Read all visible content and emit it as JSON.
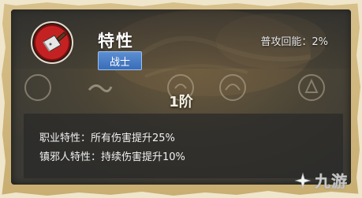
{
  "trait": {
    "title": "特性",
    "class_badge": "战士",
    "stat_label": "普攻回能：",
    "stat_value": "2%",
    "level": "1阶",
    "tier_labels": [
      "1阶",
      "",
      "",
      "",
      "",
      ""
    ]
  },
  "description": {
    "line1_label": "职业特性：",
    "line1_text": "所有伤害提升25%",
    "line2_label": "镇邪人特性：",
    "line2_text": "持续伤害提升10%"
  },
  "watermark": {
    "text": "九游"
  },
  "colors": {
    "frame": "#d7c08a",
    "badge": "#3a6db8",
    "emblem_red": "#c42222"
  }
}
